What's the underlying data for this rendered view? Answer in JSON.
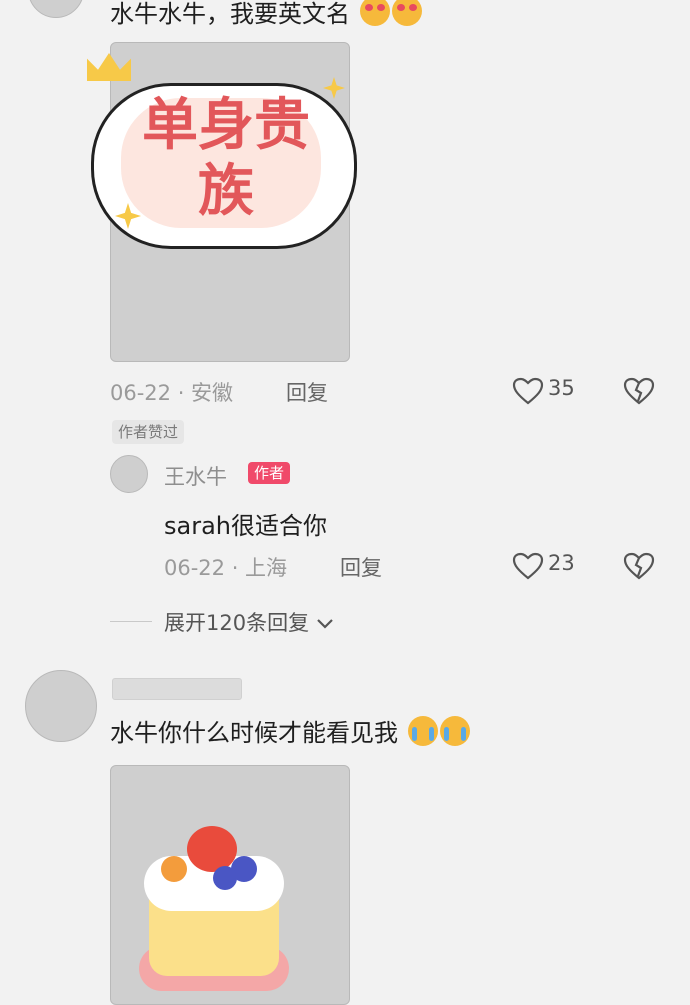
{
  "comments": [
    {
      "text": "水牛水牛，我要英文名",
      "image_sticker_text": "单身贵族",
      "meta": "06-22 · 安徽",
      "reply_label": "回复",
      "likes": "35",
      "liked_tag": "作者赞过",
      "reply": {
        "username": "王水牛",
        "author_tag": "作者",
        "text": "sarah很适合你",
        "meta": "06-22 · 上海",
        "reply_label": "回复",
        "likes": "23"
      },
      "expand_label": "展开120条回复"
    },
    {
      "text": "水牛你什么时候才能看见我"
    }
  ],
  "colors": {
    "background": "#f2f2f2",
    "author_tag": "#f04a6a",
    "sticker_text": "#e2575a"
  }
}
